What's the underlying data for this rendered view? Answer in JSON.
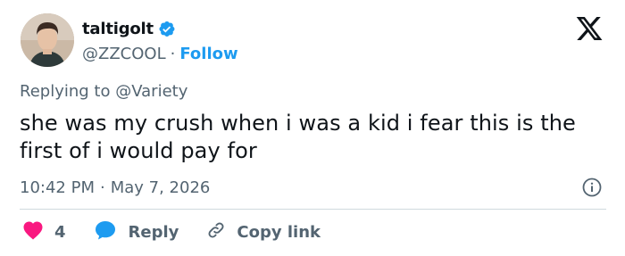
{
  "author": {
    "display_name": "taltigolt",
    "handle": "@ZZCOOL",
    "separator": "·",
    "follow_label": "Follow"
  },
  "reply_context": {
    "prefix": "Replying to",
    "handle": "@Variety"
  },
  "tweet": {
    "text": "she was my crush when i was a kid i fear this is the first of i would pay for",
    "time": "10:42 PM",
    "separator": "·",
    "date": "May 7, 2026"
  },
  "actions": {
    "like_count": "4",
    "reply_label": "Reply",
    "copy_link_label": "Copy link"
  },
  "colors": {
    "accent": "#1d9bf0",
    "like": "#f91880",
    "secondary_text": "#536471",
    "primary_text": "#0f1419"
  },
  "icons": {
    "verified": "verified-badge-icon",
    "logo": "x-logo-icon",
    "info": "info-icon",
    "like": "heart-icon",
    "reply": "chat-bubble-icon",
    "copy": "link-icon"
  }
}
